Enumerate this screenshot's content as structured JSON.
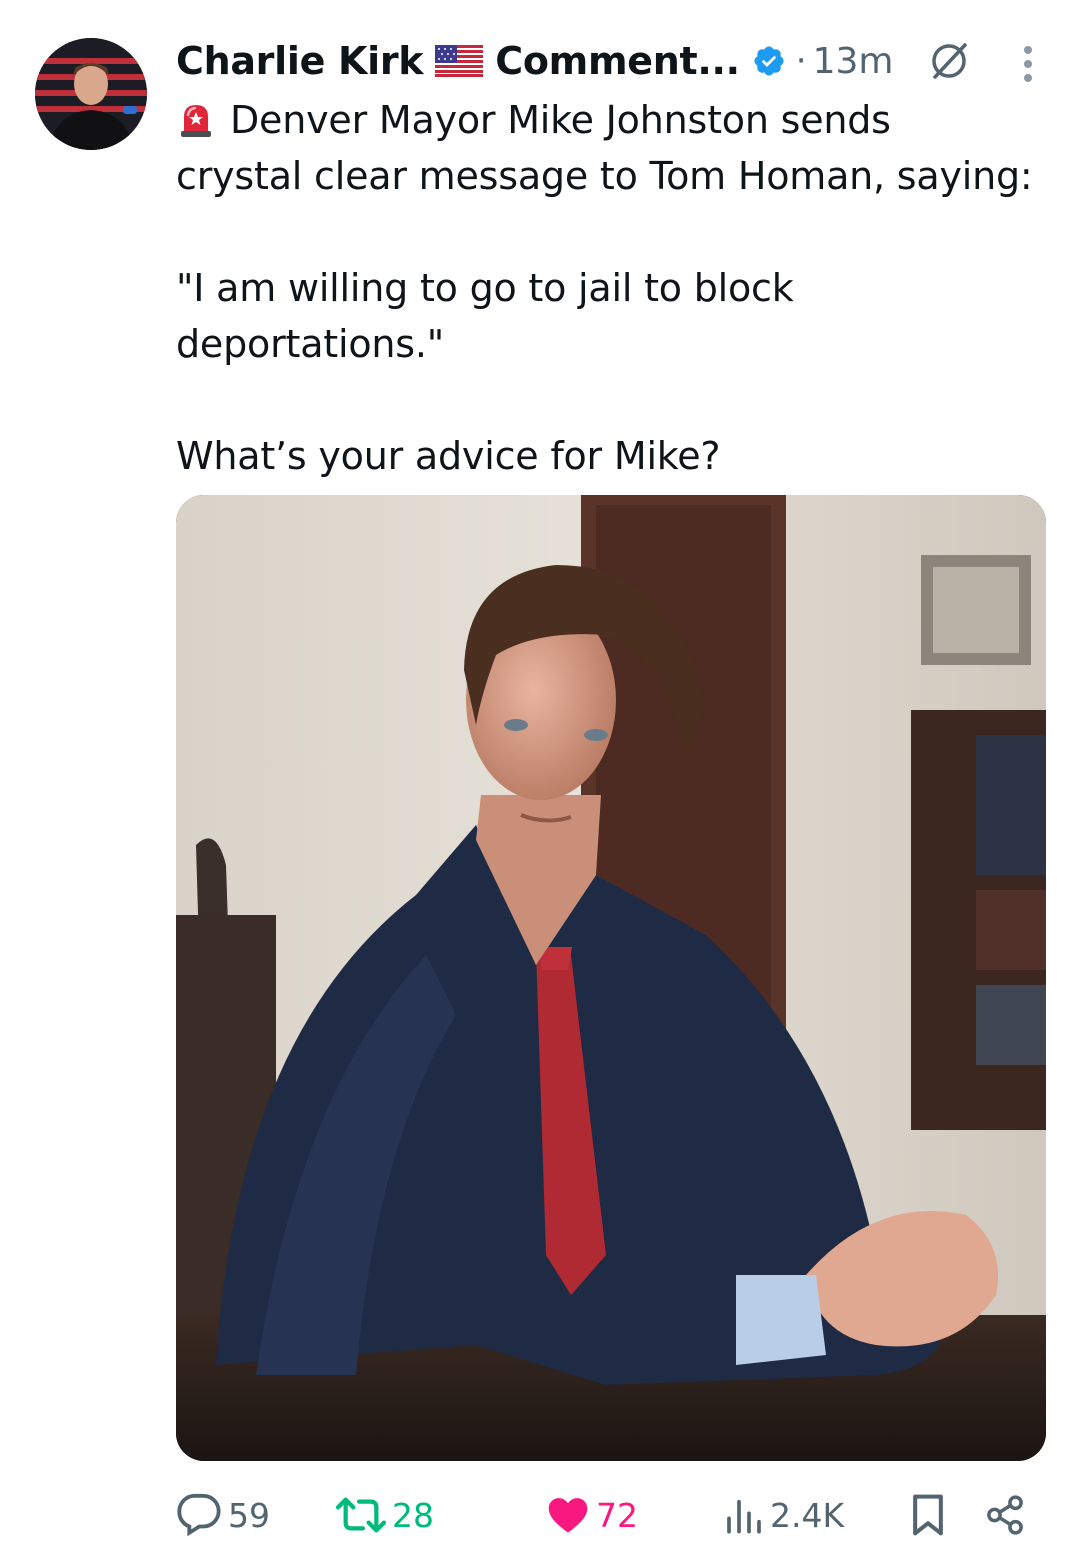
{
  "post": {
    "author_name": "Charlie Kirk",
    "community_name": "Comment...",
    "separator": "·",
    "timestamp": "13m",
    "text_line1": "Denver Mayor Mike Johnston sends",
    "text_line2": "crystal clear message to Tom Homan, saying:",
    "text_quote1": "\"I am willing to go to jail to block",
    "text_quote2": "deportations.\"",
    "text_question": "What’s your advice for Mike?"
  },
  "icons": {
    "avatar": "profile-photo",
    "flag": "us-flag-emoji",
    "verified": "verified-badge-icon",
    "grok": "grok-icon",
    "more": "more-vertical-icon",
    "siren": "police-light-emoji",
    "reply": "reply-icon",
    "repost": "repost-icon",
    "like": "heart-icon",
    "views": "views-icon",
    "bookmark": "bookmark-icon",
    "share": "share-icon"
  },
  "stats": {
    "replies": "59",
    "reposts": "28",
    "likes": "72",
    "views": "2.4K"
  },
  "colors": {
    "verified_blue": "#1d9bf0",
    "repost_green": "#00ba7c",
    "like_pink": "#f91880",
    "muted_gray": "#536471"
  }
}
